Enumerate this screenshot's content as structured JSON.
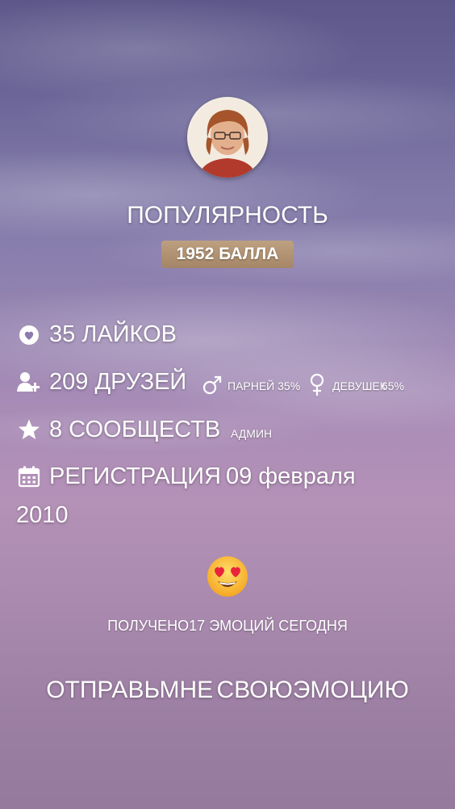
{
  "profile": {
    "popularity_label": "ПОПУЛЯРНОСТЬ",
    "score_label": "1952 БАЛЛА"
  },
  "stats": {
    "likes": {
      "icon": "heart-icon",
      "text": "35 ЛАЙКОВ"
    },
    "friends": {
      "icon": "add-friend-icon",
      "text": "209 ДРУЗЕЙ",
      "male_icon": "male-symbol-icon",
      "male_label": "ПАРНЕЙ",
      "male_percent": "35%",
      "female_icon": "female-symbol-icon",
      "female_label": "ДЕВУШЕК",
      "female_percent": "65%"
    },
    "communities": {
      "icon": "star-icon",
      "text": "8 СООБЩЕСТВ",
      "role": "АДМИН"
    },
    "registration": {
      "icon": "calendar-icon",
      "label": "РЕГИСТРАЦИЯ",
      "date_part1": "09 февраля",
      "date_part2": "2010"
    }
  },
  "emotions": {
    "icon": "heart-eyes-emoji-icon",
    "received_prefix": "ПОЛУЧЕНО",
    "received_count": "17",
    "received_suffix": "ЭМОЦИЙ СЕГОДНЯ"
  },
  "send_button": {
    "part1": "ОТПРАВЬ",
    "part2": "МНЕ",
    "part3": "СВОЮ",
    "part4": "ЭМОЦИЮ"
  }
}
